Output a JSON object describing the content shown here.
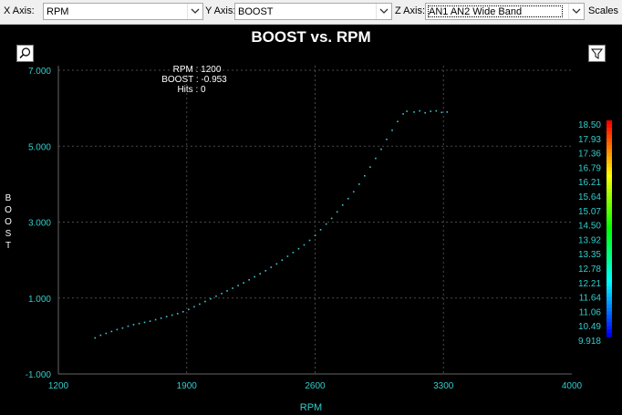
{
  "toolbar": {
    "x_label": "X Axis:",
    "x_value": "RPM",
    "y_label": "Y Axis:",
    "y_value": "BOOST",
    "z_label": "Z Axis:",
    "z_value": "AN1 AN2 Wide Band",
    "scales_label": "Scales"
  },
  "cursor_readout": {
    "rpm": "RPM : 1200",
    "boost": "BOOST : -0.953",
    "hits": "Hits : 0"
  },
  "icons": {
    "zoom": "zoom-icon",
    "filter": "filter-icon",
    "dropdown": "chevron-down-icon"
  },
  "colors": {
    "background": "#000000",
    "axis_text": "#33cccc",
    "points": "#3fc7d2",
    "grid": "#4a4a4a"
  },
  "chart_data": {
    "type": "scatter",
    "title": "BOOST vs. RPM",
    "xlabel": "RPM",
    "ylabel": "BOOST",
    "xlim": [
      1200,
      4000
    ],
    "ylim": [
      -1,
      7
    ],
    "x_ticks": [
      "1200",
      "1900",
      "2600",
      "3300",
      "4000"
    ],
    "y_ticks": [
      "-1.000",
      "1.000",
      "3.000",
      "5.000",
      "7.000"
    ],
    "grid": true,
    "points": [
      {
        "x": 1400,
        "y": -0.05
      },
      {
        "x": 1430,
        "y": 0.02
      },
      {
        "x": 1460,
        "y": 0.07
      },
      {
        "x": 1490,
        "y": 0.12
      },
      {
        "x": 1520,
        "y": 0.17
      },
      {
        "x": 1550,
        "y": 0.21
      },
      {
        "x": 1580,
        "y": 0.26
      },
      {
        "x": 1610,
        "y": 0.3
      },
      {
        "x": 1640,
        "y": 0.33
      },
      {
        "x": 1670,
        "y": 0.36
      },
      {
        "x": 1700,
        "y": 0.39
      },
      {
        "x": 1730,
        "y": 0.43
      },
      {
        "x": 1760,
        "y": 0.47
      },
      {
        "x": 1790,
        "y": 0.51
      },
      {
        "x": 1820,
        "y": 0.55
      },
      {
        "x": 1850,
        "y": 0.59
      },
      {
        "x": 1880,
        "y": 0.64
      },
      {
        "x": 1910,
        "y": 0.7
      },
      {
        "x": 1940,
        "y": 0.77
      },
      {
        "x": 1970,
        "y": 0.84
      },
      {
        "x": 2000,
        "y": 0.91
      },
      {
        "x": 2030,
        "y": 0.98
      },
      {
        "x": 2060,
        "y": 1.05
      },
      {
        "x": 2090,
        "y": 1.12
      },
      {
        "x": 2120,
        "y": 1.19
      },
      {
        "x": 2150,
        "y": 1.26
      },
      {
        "x": 2180,
        "y": 1.33
      },
      {
        "x": 2210,
        "y": 1.4
      },
      {
        "x": 2240,
        "y": 1.48
      },
      {
        "x": 2270,
        "y": 1.56
      },
      {
        "x": 2300,
        "y": 1.64
      },
      {
        "x": 2330,
        "y": 1.72
      },
      {
        "x": 2360,
        "y": 1.81
      },
      {
        "x": 2390,
        "y": 1.9
      },
      {
        "x": 2420,
        "y": 2.0
      },
      {
        "x": 2450,
        "y": 2.1
      },
      {
        "x": 2480,
        "y": 2.2
      },
      {
        "x": 2510,
        "y": 2.3
      },
      {
        "x": 2540,
        "y": 2.4
      },
      {
        "x": 2570,
        "y": 2.52
      },
      {
        "x": 2600,
        "y": 2.65
      },
      {
        "x": 2630,
        "y": 2.8
      },
      {
        "x": 2660,
        "y": 2.95
      },
      {
        "x": 2690,
        "y": 3.1
      },
      {
        "x": 2720,
        "y": 3.27
      },
      {
        "x": 2750,
        "y": 3.45
      },
      {
        "x": 2780,
        "y": 3.62
      },
      {
        "x": 2810,
        "y": 3.8
      },
      {
        "x": 2840,
        "y": 4.0
      },
      {
        "x": 2870,
        "y": 4.22
      },
      {
        "x": 2900,
        "y": 4.45
      },
      {
        "x": 2930,
        "y": 4.68
      },
      {
        "x": 2960,
        "y": 4.92
      },
      {
        "x": 2990,
        "y": 5.18
      },
      {
        "x": 3020,
        "y": 5.42
      },
      {
        "x": 3050,
        "y": 5.65
      },
      {
        "x": 3080,
        "y": 5.85
      },
      {
        "x": 3100,
        "y": 5.92
      },
      {
        "x": 3140,
        "y": 5.9
      },
      {
        "x": 3170,
        "y": 5.93
      },
      {
        "x": 3200,
        "y": 5.88
      },
      {
        "x": 3230,
        "y": 5.92
      },
      {
        "x": 3260,
        "y": 5.93
      },
      {
        "x": 3290,
        "y": 5.89
      },
      {
        "x": 3320,
        "y": 5.9
      }
    ],
    "colorbar": {
      "label_source": "AN1 AN2 Wide Band",
      "ticks": [
        "18.50",
        "17.93",
        "17.36",
        "16.79",
        "16.21",
        "15.64",
        "15.07",
        "14.50",
        "13.92",
        "13.35",
        "12.78",
        "12.21",
        "11.64",
        "11.06",
        "10.49",
        "9.918"
      ]
    }
  }
}
